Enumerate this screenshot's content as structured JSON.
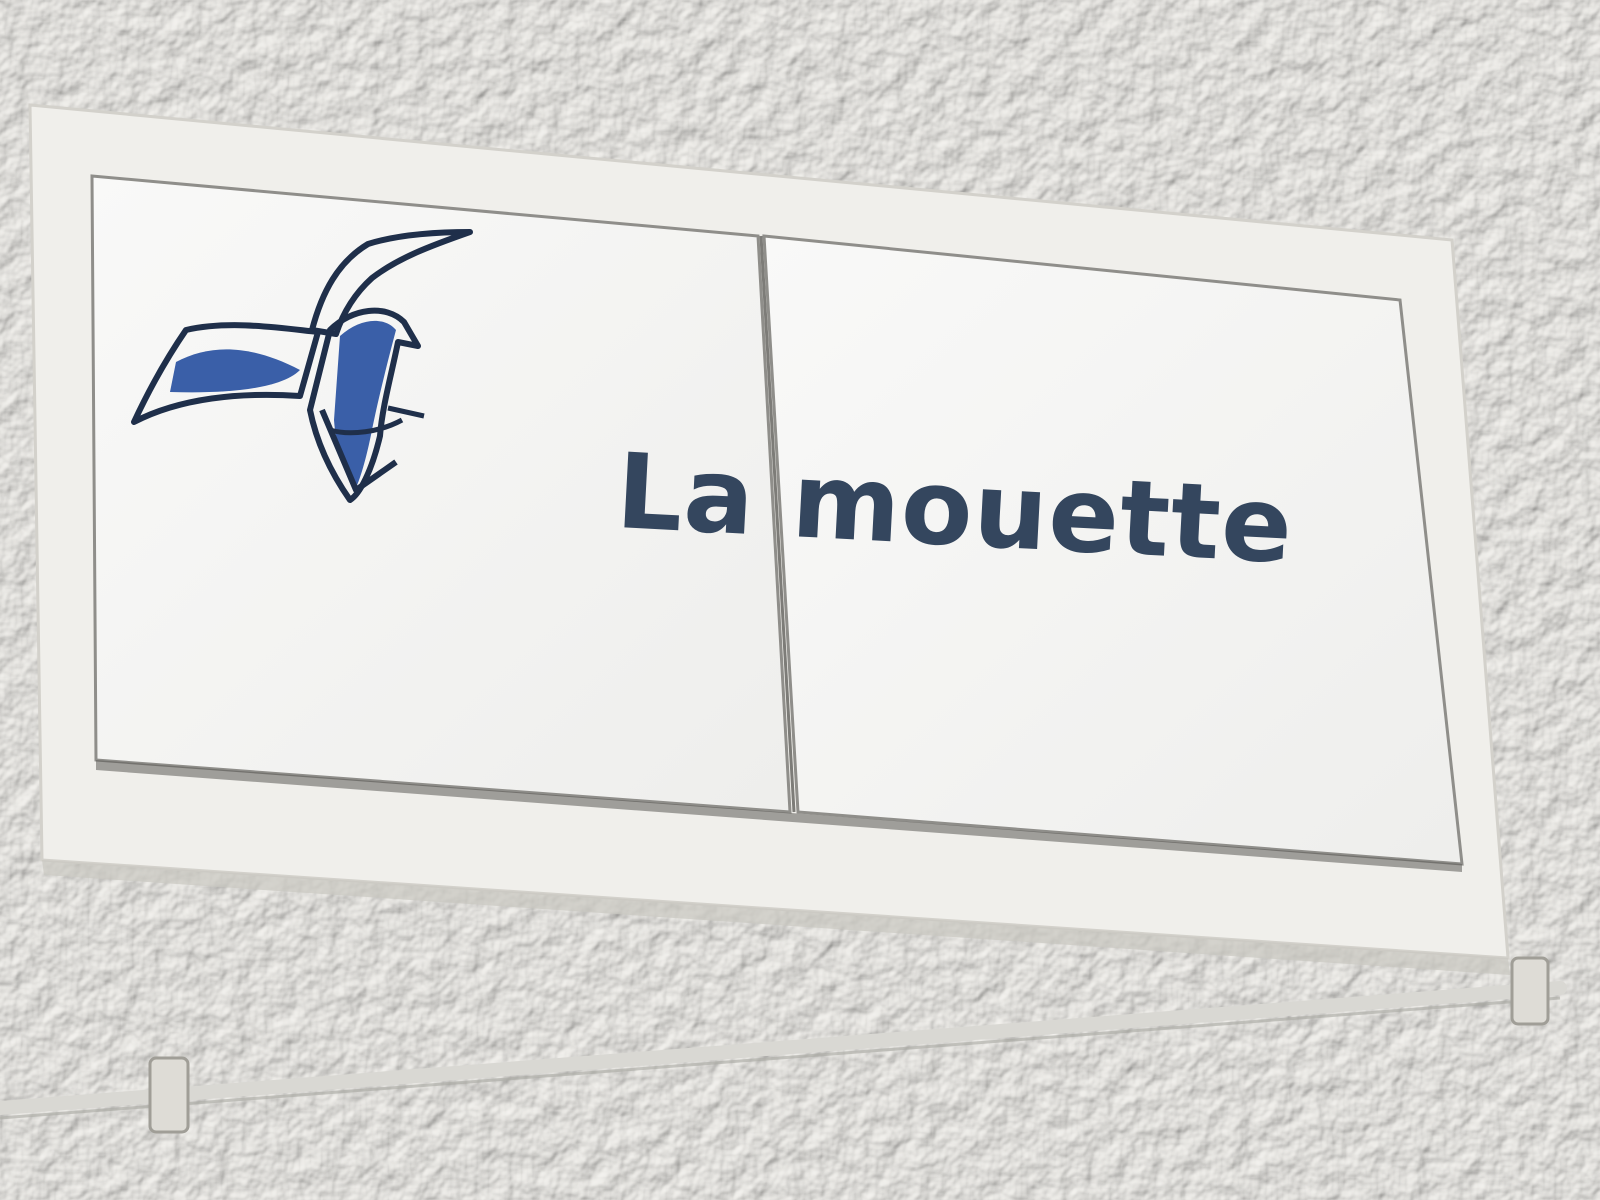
{
  "sign": {
    "text_line": "La mouette",
    "icon": "seagull-icon"
  },
  "colors": {
    "wall": "#ecebe7",
    "tile": "#f7f7f5",
    "text": "#34465e",
    "bird": "#3a5fa8",
    "outline": "#1f2f4a"
  }
}
